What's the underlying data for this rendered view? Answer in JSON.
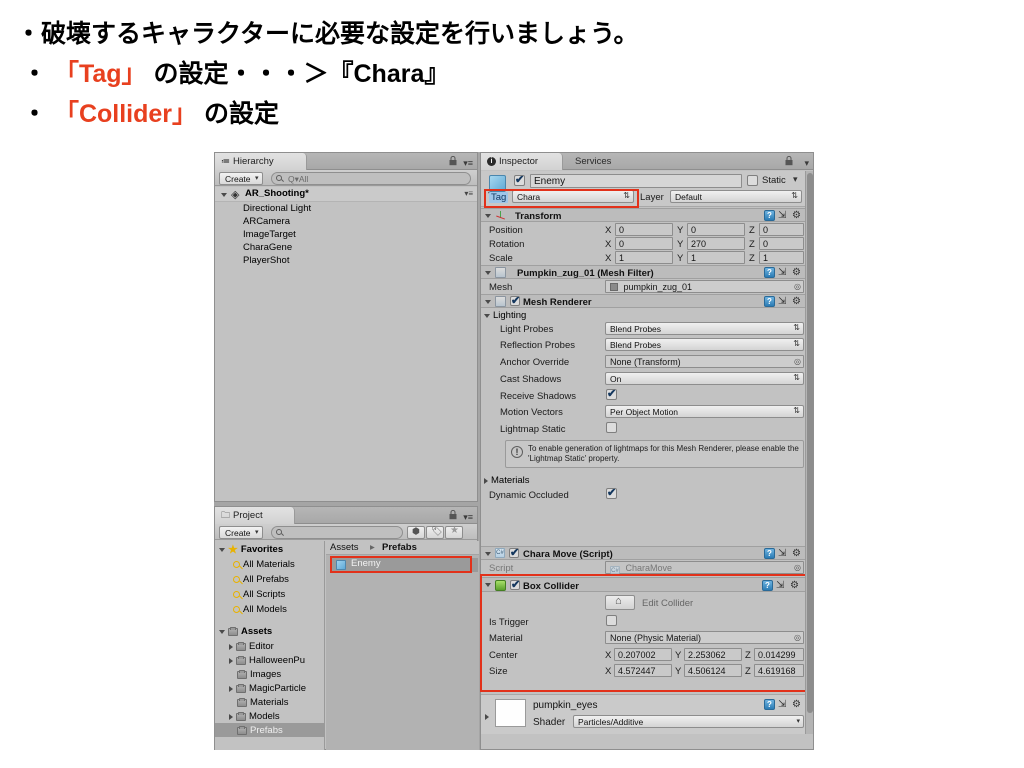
{
  "slide": {
    "lines": [
      {
        "plain_before": "・破壊するキャラクターに必要な設定を行いましょう。",
        "highlight": "",
        "plain_after": ""
      },
      {
        "plain_before": "・ ",
        "highlight": "「Tag」",
        "plain_after": " の設定・・・＞『Chara』"
      },
      {
        "plain_before": "・ ",
        "highlight": "「Collider」",
        "plain_after": " の設定"
      }
    ],
    "highlight_color": "#e8401f"
  },
  "hierarchy": {
    "tab_label": "Hierarchy",
    "create_label": "Create",
    "search_placeholder": "Q▾All",
    "scene": "AR_Shooting*",
    "items": [
      {
        "label": "Directional Light"
      },
      {
        "label": "ARCamera"
      },
      {
        "label": "ImageTarget"
      },
      {
        "label": "CharaGene"
      },
      {
        "label": "PlayerShot"
      }
    ]
  },
  "project": {
    "tab_label": "Project",
    "create_label": "Create",
    "search_placeholder": "",
    "favorites_label": "Favorites",
    "favorites": [
      {
        "label": "All Materials"
      },
      {
        "label": "All Prefabs"
      },
      {
        "label": "All Scripts"
      },
      {
        "label": "All Models"
      }
    ],
    "assets_label": "Assets",
    "assets": [
      {
        "label": "Editor",
        "expandable": true,
        "selected": false
      },
      {
        "label": "HalloweenPu",
        "expandable": true,
        "selected": false
      },
      {
        "label": "Images",
        "expandable": false,
        "selected": false
      },
      {
        "label": "MagicParticle",
        "expandable": true,
        "selected": false
      },
      {
        "label": "Materials",
        "expandable": false,
        "selected": false
      },
      {
        "label": "Models",
        "expandable": true,
        "selected": false
      },
      {
        "label": "Prefabs",
        "expandable": false,
        "selected": true
      }
    ],
    "breadcrumb": [
      "Assets",
      "Prefabs"
    ],
    "breadcrumb_sep": "▸",
    "grid_items": [
      {
        "label": "Enemy",
        "selected": true
      }
    ]
  },
  "inspector": {
    "tabs": [
      {
        "label": "Inspector",
        "active": true
      },
      {
        "label": "Services",
        "active": false
      }
    ],
    "object": {
      "name": "Enemy",
      "enabled": true,
      "static_label": "Static",
      "static_checked": false,
      "tag_label": "Tag",
      "tag_value": "Chara",
      "layer_label": "Layer",
      "layer_value": "Default"
    },
    "transform": {
      "title": "Transform",
      "rows": [
        {
          "label": "Position",
          "x": "0",
          "y": "0",
          "z": "0"
        },
        {
          "label": "Rotation",
          "x": "0",
          "y": "270",
          "z": "0"
        },
        {
          "label": "Scale",
          "x": "1",
          "y": "1",
          "z": "1"
        }
      ],
      "axis_labels": [
        "X",
        "Y",
        "Z"
      ]
    },
    "mesh_filter": {
      "title": "Pumpkin_zug_01 (Mesh Filter)",
      "mesh_label": "Mesh",
      "mesh_value": "pumpkin_zug_01"
    },
    "mesh_renderer": {
      "title": "Mesh Renderer",
      "enabled": true,
      "lighting_label": "Lighting",
      "rows": [
        {
          "label": "Light Probes",
          "value": "Blend Probes",
          "kind": "popup"
        },
        {
          "label": "Reflection Probes",
          "value": "Blend Probes",
          "kind": "popup"
        },
        {
          "label": "Anchor Override",
          "value": "None (Transform)",
          "kind": "object"
        },
        {
          "label": "Cast Shadows",
          "value": "On",
          "kind": "popup"
        },
        {
          "label": "Receive Shadows",
          "value": "",
          "kind": "checkbox-on"
        },
        {
          "label": "Motion Vectors",
          "value": "Per Object Motion",
          "kind": "popup"
        },
        {
          "label": "Lightmap Static",
          "value": "",
          "kind": "checkbox-off"
        }
      ],
      "help_text": "To enable generation of lightmaps for this Mesh Renderer, please enable the 'Lightmap Static' property.",
      "help_icon": "!",
      "materials_label": "Materials",
      "dynamic_occluded_label": "Dynamic Occluded",
      "dynamic_occluded_checked": true
    },
    "chara_move": {
      "title": "Chara Move (Script)",
      "enabled": true,
      "script_label": "Script",
      "script_value": "CharaMove"
    },
    "box_collider": {
      "title": "Box Collider",
      "enabled": true,
      "edit_collider_label": "Edit Collider",
      "is_trigger_label": "Is Trigger",
      "is_trigger_checked": false,
      "material_label": "Material",
      "material_value": "None (Physic Material)",
      "center_label": "Center",
      "center": {
        "x": "0.207002",
        "y": "2.253062",
        "z": "0.014299"
      },
      "size_label": "Size",
      "size": {
        "x": "4.572447",
        "y": "4.506124",
        "z": "4.619168"
      },
      "axis_labels": [
        "X",
        "Y",
        "Z"
      ]
    },
    "material_preview": {
      "title": "pumpkin_eyes",
      "shader_label": "Shader",
      "shader_value": "Particles/Additive"
    }
  },
  "annotations": {
    "highlight_color": "#e2311a",
    "boxes": [
      "tag-row",
      "box-collider-component",
      "project-enemy-item"
    ]
  }
}
